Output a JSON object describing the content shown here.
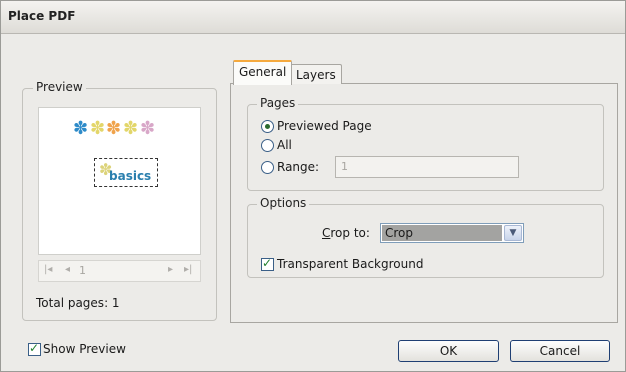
{
  "window": {
    "title": "Place PDF"
  },
  "preview": {
    "legend": "Preview",
    "nav": {
      "first_icon": "first-page-icon",
      "prev_icon": "prev-page-icon",
      "page_value": "1",
      "next_icon": "next-page-icon",
      "last_icon": "last-page-icon"
    },
    "total_label": "Total pages: 1",
    "thumbnail": {
      "logo_text": "basics",
      "flower_colors": [
        "#2e8bc9",
        "#e3d66a",
        "#f0a34b",
        "#e2d66a",
        "#d8a7c8"
      ]
    }
  },
  "tabs": [
    {
      "label": "General",
      "active": true
    },
    {
      "label": "Layers",
      "active": false
    }
  ],
  "pages": {
    "legend": "Pages",
    "options": [
      {
        "label": "Previewed Page",
        "selected": true
      },
      {
        "label": "All",
        "selected": false
      },
      {
        "label": "Range:",
        "selected": false
      }
    ],
    "range_value": "1"
  },
  "options": {
    "legend": "Options",
    "crop_label_prefix": "C",
    "crop_label_rest": "rop to:",
    "crop_value": "Crop",
    "transparent_background": {
      "label": "Transparent Background",
      "checked": true
    }
  },
  "footer": {
    "show_preview": {
      "label": "Show Preview",
      "checked": true
    },
    "ok_label": "OK",
    "cancel_label": "Cancel"
  }
}
